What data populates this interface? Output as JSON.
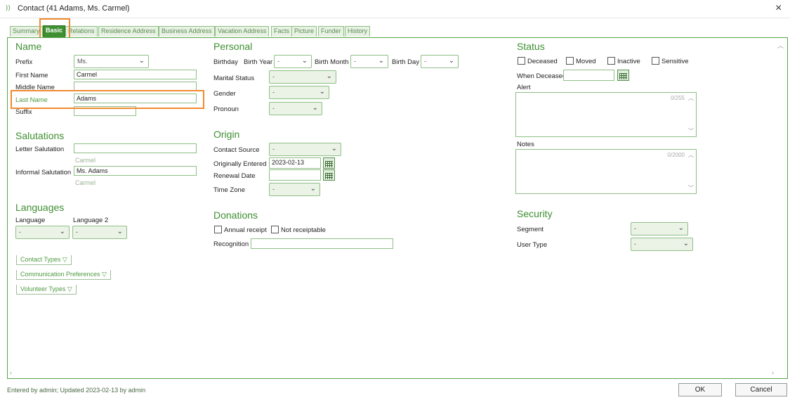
{
  "window": {
    "title": "Contact (41   Adams, Ms. Carmel)",
    "close": "×",
    "icon": "contact-app-icon"
  },
  "tabs": [
    {
      "label": "Summary"
    },
    {
      "label": "Basic",
      "active": true
    },
    {
      "label": "Relations"
    },
    {
      "label": "Residence Address"
    },
    {
      "label": "Business Address"
    },
    {
      "label": "Vacation Address"
    },
    {
      "label": "Facts"
    },
    {
      "label": "Picture"
    },
    {
      "label": "Funder"
    },
    {
      "label": "History"
    }
  ],
  "name": {
    "section": "Name",
    "prefix_label": "Prefix",
    "prefix_value": "Ms.",
    "first_label": "First Name",
    "first_value": "Carmel",
    "middle_label": "Middle Name",
    "middle_value": "",
    "last_label": "Last Name",
    "last_value": "Adams",
    "suffix_label": "Suffix",
    "suffix_value": ""
  },
  "salutations": {
    "section": "Salutations",
    "letter_label": "Letter Salutation",
    "letter_value": "",
    "letter_hint": "Carmel",
    "informal_label": "Informal Salutation",
    "informal_value": "Ms. Adams",
    "informal_hint": "Carmel"
  },
  "languages": {
    "section": "Languages",
    "lang1_label": "Language",
    "lang1_value": "-",
    "lang2_label": "Language 2",
    "lang2_value": "-"
  },
  "collapsibles": [
    "Contact Types ▽",
    "Communication Preferences ▽",
    "Volunteer Types ▽"
  ],
  "personal": {
    "section": "Personal",
    "birthday_label": "Birthday",
    "birth_year_label": "Birth Year",
    "birth_year_value": "-",
    "birth_month_label": "Birth Month",
    "birth_month_value": "-",
    "birth_day_label": "Birth Day",
    "birth_day_value": "-",
    "marital_label": "Marital Status",
    "marital_value": "-",
    "gender_label": "Gender",
    "gender_value": "-",
    "pronoun_label": "Pronoun",
    "pronoun_value": "-"
  },
  "origin": {
    "section": "Origin",
    "source_label": "Contact Source",
    "source_value": "-",
    "entered_label": "Originally Entered",
    "entered_value": "2023-02-13",
    "renewal_label": "Renewal Date",
    "renewal_value": "",
    "tz_label": "Time Zone",
    "tz_value": "-"
  },
  "donations": {
    "section": "Donations",
    "annual_label": "Annual receipt",
    "notreceipt_label": "Not receiptable",
    "recognition_label": "Recognition",
    "recognition_value": ""
  },
  "status": {
    "section": "Status",
    "deceased_label": "Deceased",
    "moved_label": "Moved",
    "inactive_label": "Inactive",
    "sensitive_label": "Sensitive",
    "when_deceased_label": "When Deceased",
    "when_deceased_value": "",
    "alert_label": "Alert",
    "alert_counter": "0/255",
    "notes_label": "Notes",
    "notes_counter": "0/2000"
  },
  "security": {
    "section": "Security",
    "segment_label": "Segment",
    "segment_value": "-",
    "usertype_label": "User Type",
    "usertype_value": "-"
  },
  "footer": {
    "status_text": "Entered by admin; Updated 2023-02-13 by admin",
    "ok_label": "OK",
    "cancel_label": "Cancel"
  },
  "colors": {
    "accent": "#3e8f31",
    "highlight": "#f08a30",
    "border": "#8fbf86"
  }
}
